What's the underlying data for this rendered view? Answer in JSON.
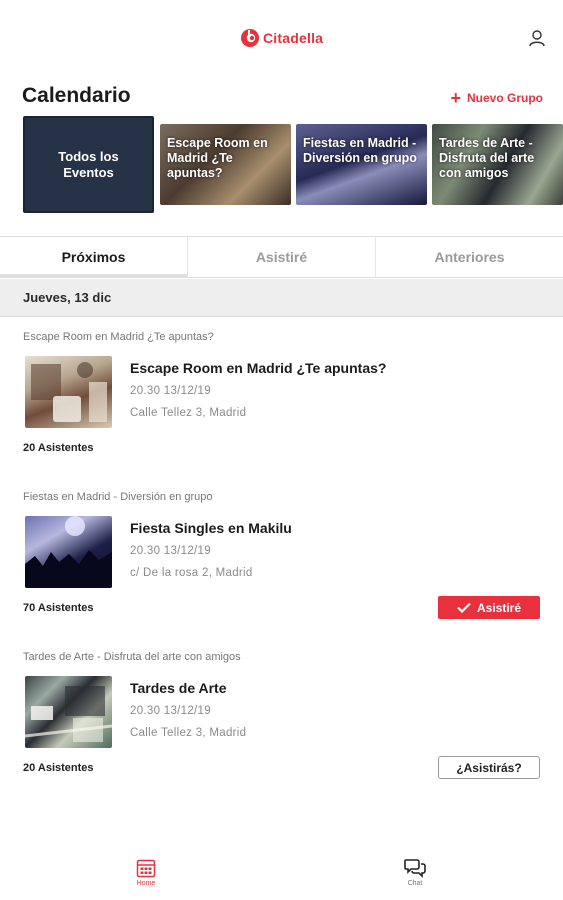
{
  "app": {
    "name": "Citadella",
    "brand_color": "#e8313d",
    "dark_color": "#263246"
  },
  "header": {
    "user_icon": "user-icon"
  },
  "calendar": {
    "title": "Calendario",
    "new_group_label": "Nuevo Grupo"
  },
  "groups": [
    {
      "label": "Todos los Eventos",
      "selected": true
    },
    {
      "label": "Escape Room en Madrid ¿Te apuntas?"
    },
    {
      "label": "Fiestas en Madrid - Diversión en grupo"
    },
    {
      "label": "Tardes de Arte - Disfruta del arte con amigos"
    }
  ],
  "tabs": [
    {
      "label": "Próximos",
      "active": true
    },
    {
      "label": "Asistiré",
      "active": false
    },
    {
      "label": "Anteriores",
      "active": false
    }
  ],
  "date_header": "Jueves, 13 dic",
  "events": [
    {
      "group": "Escape Room en Madrid ¿Te apuntas?",
      "title": "Escape Room en Madrid ¿Te apuntas?",
      "time": "20.30  13/12/19",
      "place": "Calle Tellez 3, Madrid",
      "attendees": "20 Asistentes",
      "action": ""
    },
    {
      "group": "Fiestas en Madrid - Diversión en grupo",
      "title": "Fiesta Singles en Makilu",
      "time": "20.30  13/12/19",
      "place": "c/ De la rosa 2, Madrid",
      "attendees": "70 Asistentes",
      "action": "Asistiré"
    },
    {
      "group": "Tardes de Arte - Disfruta del arte con amigos",
      "title": "Tardes de Arte",
      "time": "20.30  13/12/19",
      "place": "Calle Tellez 3, Madrid",
      "attendees": "20 Asistentes",
      "action": "¿Asistirás?"
    }
  ],
  "bottom_nav": {
    "home_label": "Home",
    "chat_label": "Chat",
    "home_icon": "calendar-grid-icon",
    "chat_icon": "chat-bubbles-icon"
  }
}
